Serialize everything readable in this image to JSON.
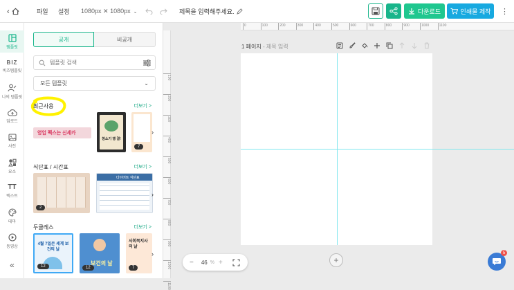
{
  "topbar": {
    "menu_file": "파일",
    "menu_settings": "설정",
    "size": "1080px ✕ 1080px",
    "title": "제목을 입력해주세요.",
    "download_label": "다운로드",
    "print_label": "인쇄물 제작"
  },
  "sidebar": {
    "items": [
      {
        "label": "템플릿",
        "glyph": ""
      },
      {
        "label": "비즈템플릿",
        "glyph": "BIZ"
      },
      {
        "label": "나의 템플릿",
        "glyph": ""
      },
      {
        "label": "업로드",
        "glyph": ""
      },
      {
        "label": "사진",
        "glyph": ""
      },
      {
        "label": "요소",
        "glyph": ""
      },
      {
        "label": "텍스트",
        "glyph": "TT"
      },
      {
        "label": "테마",
        "glyph": ""
      },
      {
        "label": "동영상",
        "glyph": ""
      }
    ],
    "collapse": "«"
  },
  "panel": {
    "tab_public": "공개",
    "tab_private": "비공개",
    "search_placeholder": "템플릿 검색",
    "filter_label": "모든 템플릿",
    "sections": [
      {
        "title": "최근사용",
        "more": "더보기 >"
      },
      {
        "title": "식단표 / 시간표",
        "more": "더보기 >"
      },
      {
        "title": "두클레스",
        "more": "더보기 >"
      }
    ],
    "thumbs": {
      "recent_banner": "영업 팩스는 신세카",
      "recent_card_title": "청소기 행 결!",
      "recent_badge": "7",
      "meal_badge": "2",
      "meal2_title": "다이어트 식단표",
      "event_title": "4월 7일은 세계 보건의 날",
      "event_badge": "12",
      "event2_text": "보건의 날",
      "event2_badge": "12",
      "event3_text": "사회복지사의 날",
      "event3_badge": "7"
    }
  },
  "canvas": {
    "ruler_h": [
      "0",
      "100",
      "200",
      "300",
      "400",
      "500",
      "600",
      "700",
      "800",
      "900",
      "1000",
      "1100"
    ],
    "ruler_v": [
      "100",
      "200",
      "300",
      "400",
      "500",
      "600",
      "700",
      "800",
      "900",
      "1000",
      "1100"
    ],
    "page_number": "1 페이지",
    "page_title_placeholder": "- 제목 입력",
    "zoom_minus": "−",
    "zoom_value": "46",
    "zoom_unit": "%",
    "zoom_plus": "+",
    "add_page": "+",
    "chat_badge": "5"
  },
  "colors": {
    "accent": "#18b58b",
    "print_blue": "#17a9e0",
    "guide": "#7ee6ee",
    "highlight": "#fff200"
  }
}
